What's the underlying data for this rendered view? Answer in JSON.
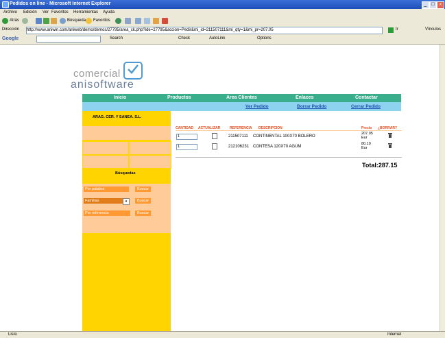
{
  "window": {
    "title": "Pedidos on line - Microsoft Internet Explorer"
  },
  "menubar": [
    "Archivo",
    "Edición",
    "Ver",
    "Favoritos",
    "Herramientas",
    "Ayuda"
  ],
  "toolbar": {
    "back": "Atrás",
    "search": "Búsqueda",
    "favorites": "Favoritos"
  },
  "address": {
    "label": "Dirección",
    "url": "http://www.aniwin.com/aniweb/demo/demos/27795/area_ck.php?ide=27795&accion=Pedir&mi_id=211507111&mi_qty=1&mi_pr=207.05",
    "go": "Ir",
    "links": "Vínculos"
  },
  "google": {
    "brand": "Google",
    "search": "Search",
    "check": "Check",
    "autolink": "AutoLink",
    "options": "Options"
  },
  "status": {
    "left": "Listo",
    "zone": "Internet"
  },
  "logo": {
    "line1": "comercial",
    "line2": "anisoftware"
  },
  "nav": [
    "Inicio",
    "Productos",
    "Area Clientes",
    "Enlaces",
    "Contactar"
  ],
  "subnav": [
    "Ver Pedido",
    "Borrar Pedido",
    "Cerrar Pedido"
  ],
  "sidebar": {
    "company": "ARAG. CER. Y SANEA. S.L.",
    "search_title": "Búsquedas",
    "rows": [
      {
        "input": "Por palabra",
        "button": "Buscar"
      },
      {
        "input": "Familias",
        "button": "Buscar"
      },
      {
        "input": "Por referencia",
        "button": "Buscar"
      }
    ]
  },
  "cart": {
    "headers": {
      "qty": "CANTIDAD",
      "update": "ACTUALIZAR",
      "ref": "REFERENCIA",
      "desc": "DESCRIPCION",
      "price": "Precio",
      "delete": "¿BORRAR?"
    },
    "rows": [
      {
        "qty": "1",
        "ref": "211507111",
        "desc": "CONTINENTAL 100X70 BOLERO",
        "price": "207.05",
        "currency": "Eur"
      },
      {
        "qty": "1",
        "ref": "212106231",
        "desc": "CONTESA 120X70 AGUM",
        "price": "80.10",
        "currency": "Eur"
      }
    ],
    "total": "Total:287.15"
  }
}
